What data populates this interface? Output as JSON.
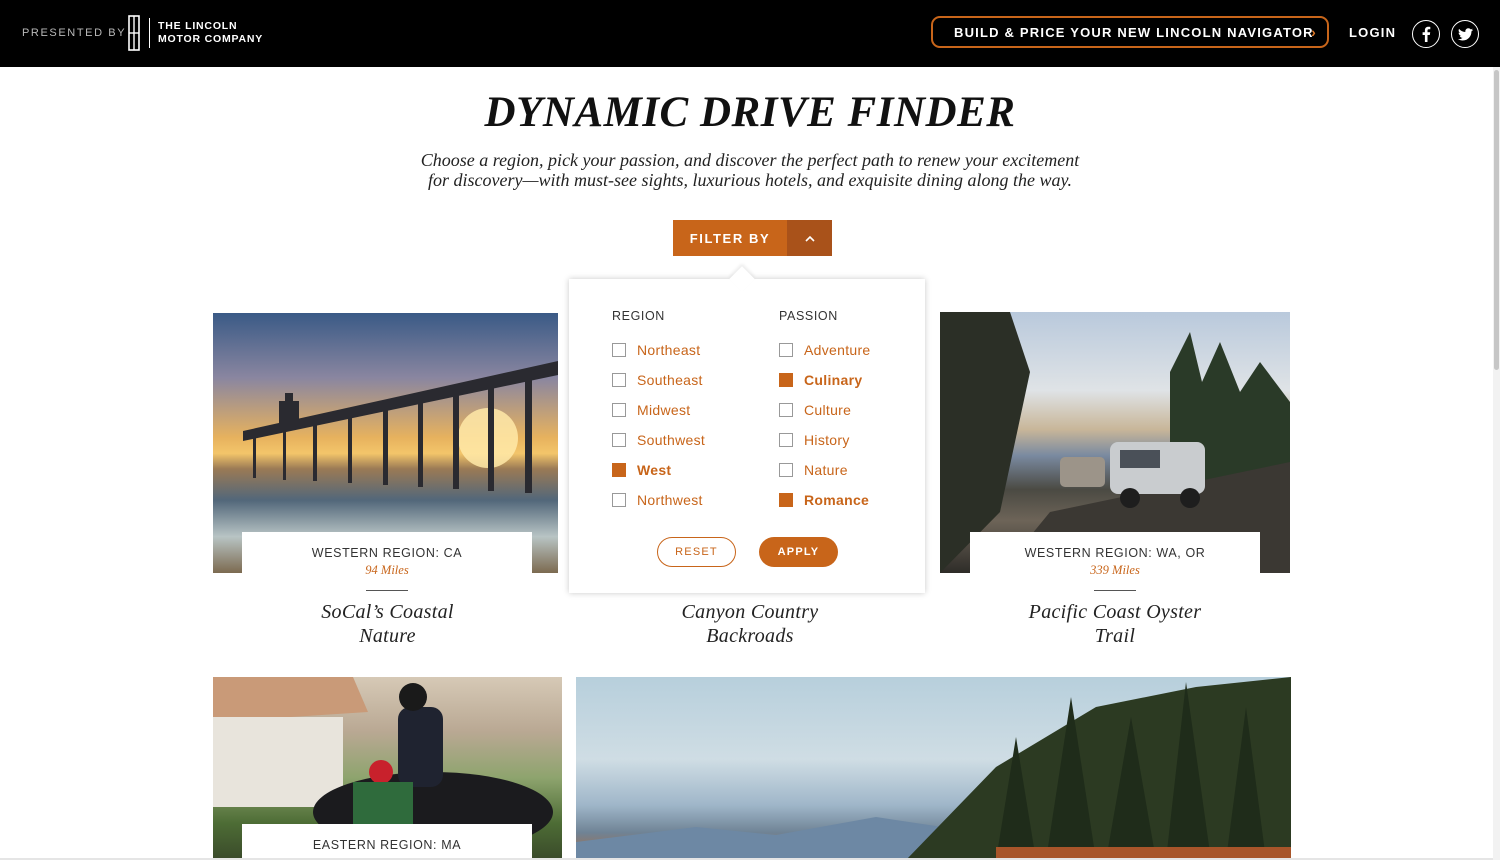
{
  "header": {
    "presented_by": "PRESENTED BY",
    "brand_line1": "THE LINCOLN",
    "brand_line2": "MOTOR COMPANY",
    "build_price_label": "BUILD & PRICE YOUR NEW LINCOLN NAVIGATOR",
    "login_label": "LOGIN",
    "social_icons": [
      "facebook-icon",
      "twitter-icon"
    ]
  },
  "page": {
    "title": "DYNAMIC DRIVE FINDER",
    "description_line1": "Choose a region, pick your passion, and discover the perfect path to renew your excitement",
    "description_line2": "for discovery—with must-see sights, luxurious hotels, and exquisite dining along the way."
  },
  "filter": {
    "button_label": "FILTER BY",
    "toggle_icon": "chevron-up-icon",
    "region_heading": "REGION",
    "passion_heading": "PASSION",
    "regions": [
      {
        "label": "Northeast",
        "checked": false
      },
      {
        "label": "Southeast",
        "checked": false
      },
      {
        "label": "Midwest",
        "checked": false
      },
      {
        "label": "Southwest",
        "checked": false
      },
      {
        "label": "West",
        "checked": true
      },
      {
        "label": "Northwest",
        "checked": false
      }
    ],
    "passions": [
      {
        "label": "Adventure",
        "checked": false
      },
      {
        "label": "Culinary",
        "checked": true
      },
      {
        "label": "Culture",
        "checked": false
      },
      {
        "label": "History",
        "checked": false
      },
      {
        "label": "Nature",
        "checked": false
      },
      {
        "label": "Romance",
        "checked": true
      }
    ],
    "reset_label": "RESET",
    "apply_label": "APPLY"
  },
  "cards": [
    {
      "region": "WESTERN REGION: CA",
      "miles": "94 Miles",
      "title_line1": "SoCal’s Coastal",
      "title_line2": "Nature"
    },
    {
      "title_line1": "Canyon Country",
      "title_line2": "Backroads"
    },
    {
      "region": "WESTERN REGION: WA, OR",
      "miles": "339 Miles",
      "title_line1": "Pacific Coast Oyster",
      "title_line2": "Trail"
    },
    {
      "region": "EASTERN REGION: MA"
    }
  ],
  "colors": {
    "accent": "#c8651a",
    "accent_dark": "#a9521a",
    "topbar": "#000000"
  }
}
